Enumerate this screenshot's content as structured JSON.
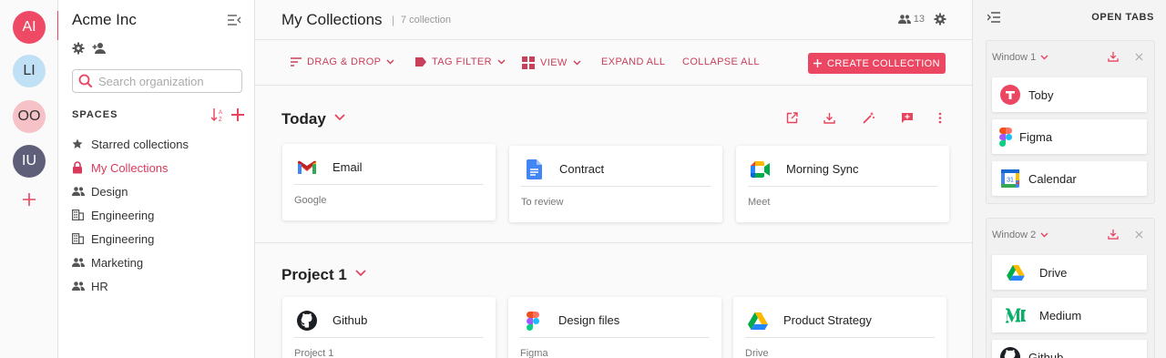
{
  "colors": {
    "accent": "#e8435f",
    "accent_text": "#c8405a",
    "rail_bg": "#fafafa"
  },
  "workspaces": [
    {
      "initials": "AI",
      "bg": "#ee4a65",
      "fg": "#ffffff"
    },
    {
      "initials": "LI",
      "bg": "#bfe0f5",
      "fg": "#333333"
    },
    {
      "initials": "OO",
      "bg": "#f6c2c8",
      "fg": "#333333"
    },
    {
      "initials": "IU",
      "bg": "#5f5f7a",
      "fg": "#ffffff"
    }
  ],
  "sidebar": {
    "org_name": "Acme Inc",
    "search_placeholder": "Search organization",
    "spaces_title": "SPACES",
    "items": [
      {
        "label": "Starred collections",
        "icon": "star-icon"
      },
      {
        "label": "My Collections",
        "icon": "lock-icon",
        "active": true
      },
      {
        "label": "Design",
        "icon": "people-icon"
      },
      {
        "label": "Engineering",
        "icon": "building-icon"
      },
      {
        "label": "Engineering",
        "icon": "building-icon"
      },
      {
        "label": "Marketing",
        "icon": "people-icon"
      },
      {
        "label": "HR",
        "icon": "people-icon"
      }
    ]
  },
  "main": {
    "title": "My Collections",
    "separator": "|",
    "count_text": "7 collection",
    "members_count": "13",
    "toolbar": {
      "drag_drop": "DRAG & DROP",
      "tag_filter": "TAG FILTER",
      "view": "VIEW",
      "expand_all": "EXPAND ALL",
      "collapse_all": "COLLAPSE ALL",
      "create": "CREATE COLLECTION"
    },
    "sections": [
      {
        "title": "Today",
        "cards": [
          {
            "title": "Email",
            "subtitle": "Google",
            "icon": "gmail-icon"
          },
          {
            "title": "Contract",
            "subtitle": "To review",
            "icon": "google-docs-icon"
          },
          {
            "title": "Morning Sync",
            "subtitle": "Meet",
            "icon": "google-meet-icon"
          }
        ]
      },
      {
        "title": "Project 1",
        "cards": [
          {
            "title": "Github",
            "subtitle": "Project 1",
            "icon": "github-icon"
          },
          {
            "title": "Design files",
            "subtitle": "Figma",
            "icon": "figma-icon"
          },
          {
            "title": "Product Strategy",
            "subtitle": "Drive",
            "icon": "google-drive-icon"
          }
        ]
      }
    ]
  },
  "right_panel": {
    "title": "OPEN TABS",
    "windows": [
      {
        "label": "Window 1",
        "tabs": [
          {
            "label": "Toby",
            "icon": "toby-icon"
          },
          {
            "label": "Figma",
            "icon": "figma-icon"
          },
          {
            "label": "Calendar",
            "icon": "google-calendar-icon",
            "badge": "31"
          }
        ]
      },
      {
        "label": "Window 2",
        "tabs": [
          {
            "label": "Drive",
            "icon": "google-drive-icon"
          },
          {
            "label": "Medium",
            "icon": "medium-icon"
          },
          {
            "label": "Github",
            "icon": "github-icon"
          }
        ]
      }
    ]
  }
}
